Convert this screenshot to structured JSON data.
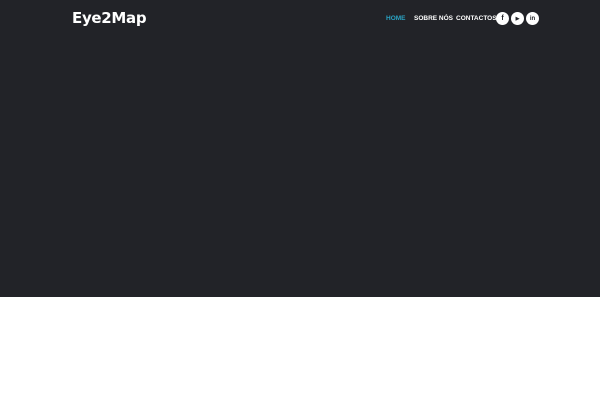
{
  "header": {
    "logo": "Eye2Map",
    "nav": [
      {
        "label": "HOME",
        "active": true
      },
      {
        "label": "SOBRE NÓS"
      },
      {
        "label": "CONTACTOS"
      }
    ],
    "social": [
      {
        "icon": "facebook-icon",
        "glyph": "f"
      },
      {
        "icon": "youtube-icon",
        "glyph": "▶"
      },
      {
        "icon": "linkedin-icon",
        "glyph": "in"
      }
    ]
  },
  "colors": {
    "hero_bg": "#222328",
    "accent": "#2aa3c4"
  }
}
